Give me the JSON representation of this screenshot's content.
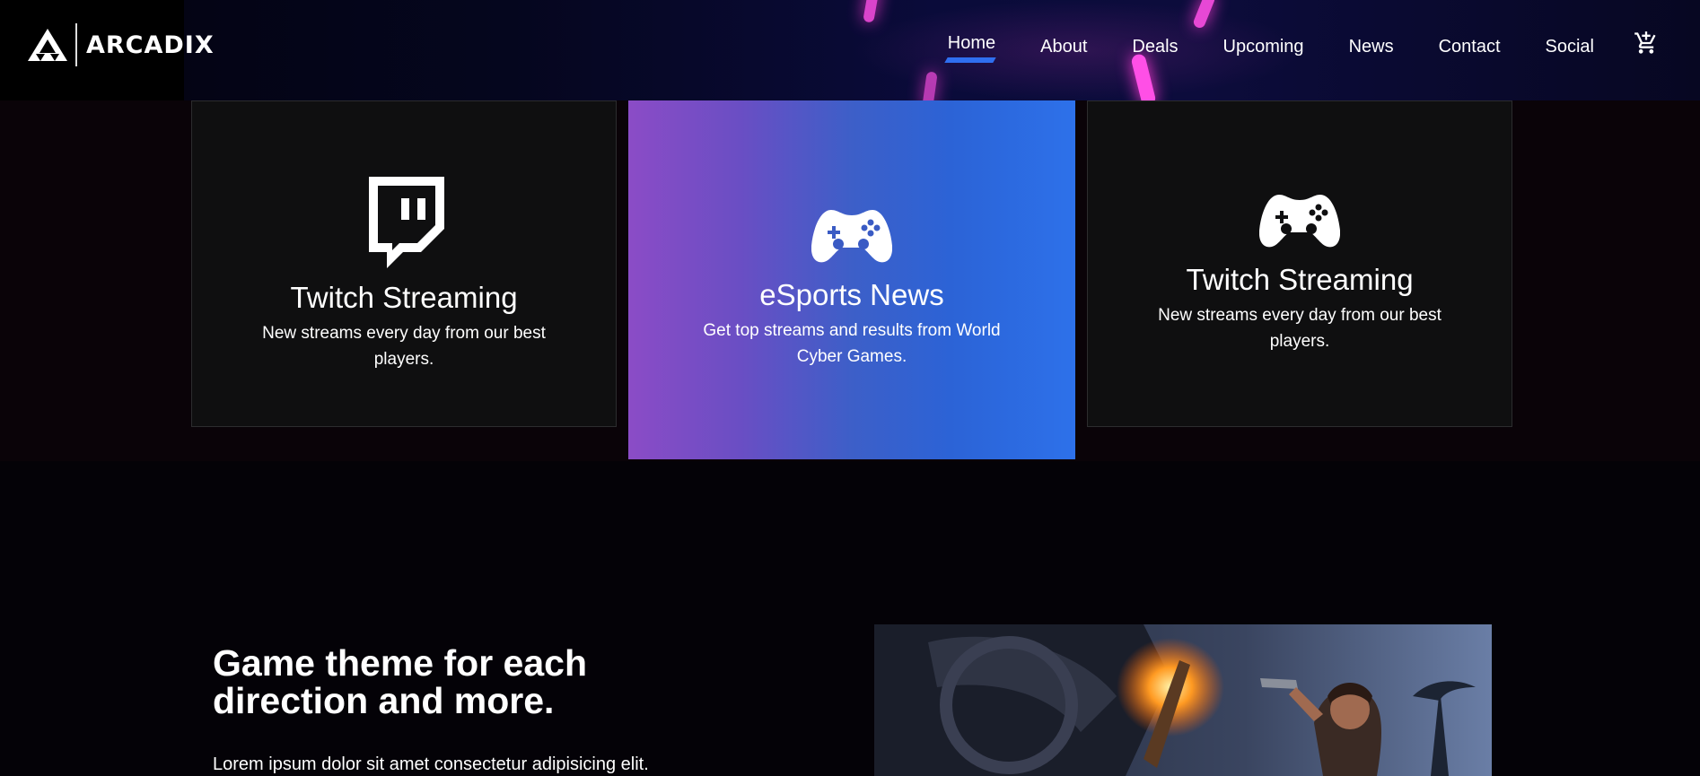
{
  "brand": {
    "name": "ARCADIX",
    "logo_icon": "triangle-logo-icon"
  },
  "nav": {
    "items": [
      {
        "label": "Home",
        "active": true
      },
      {
        "label": "About",
        "active": false
      },
      {
        "label": "Deals",
        "active": false
      },
      {
        "label": "Upcoming",
        "active": false
      },
      {
        "label": "News",
        "active": false
      },
      {
        "label": "Contact",
        "active": false
      },
      {
        "label": "Social",
        "active": false
      }
    ],
    "cart_icon": "cart-icon",
    "accent_color": "#2f6ff0"
  },
  "features": [
    {
      "icon": "twitch-icon",
      "title": "Twitch Streaming",
      "description": "New streams every day from our best players."
    },
    {
      "icon": "gamepad-icon",
      "title": "eSports News",
      "description": "Get top streams and results from World Cyber Games.",
      "highlighted": true
    },
    {
      "icon": "gamepad-icon",
      "title": "Twitch Streaming",
      "description": "New streams every day from our best players."
    }
  ],
  "about": {
    "title": "Game theme for each direction and more.",
    "text": "Lorem ipsum dolor sit amet consectetur adipisicing elit."
  },
  "colors": {
    "highlight_gradient_start": "#8b4cc6",
    "highlight_gradient_end": "#2d71ea",
    "background": "#040207"
  }
}
